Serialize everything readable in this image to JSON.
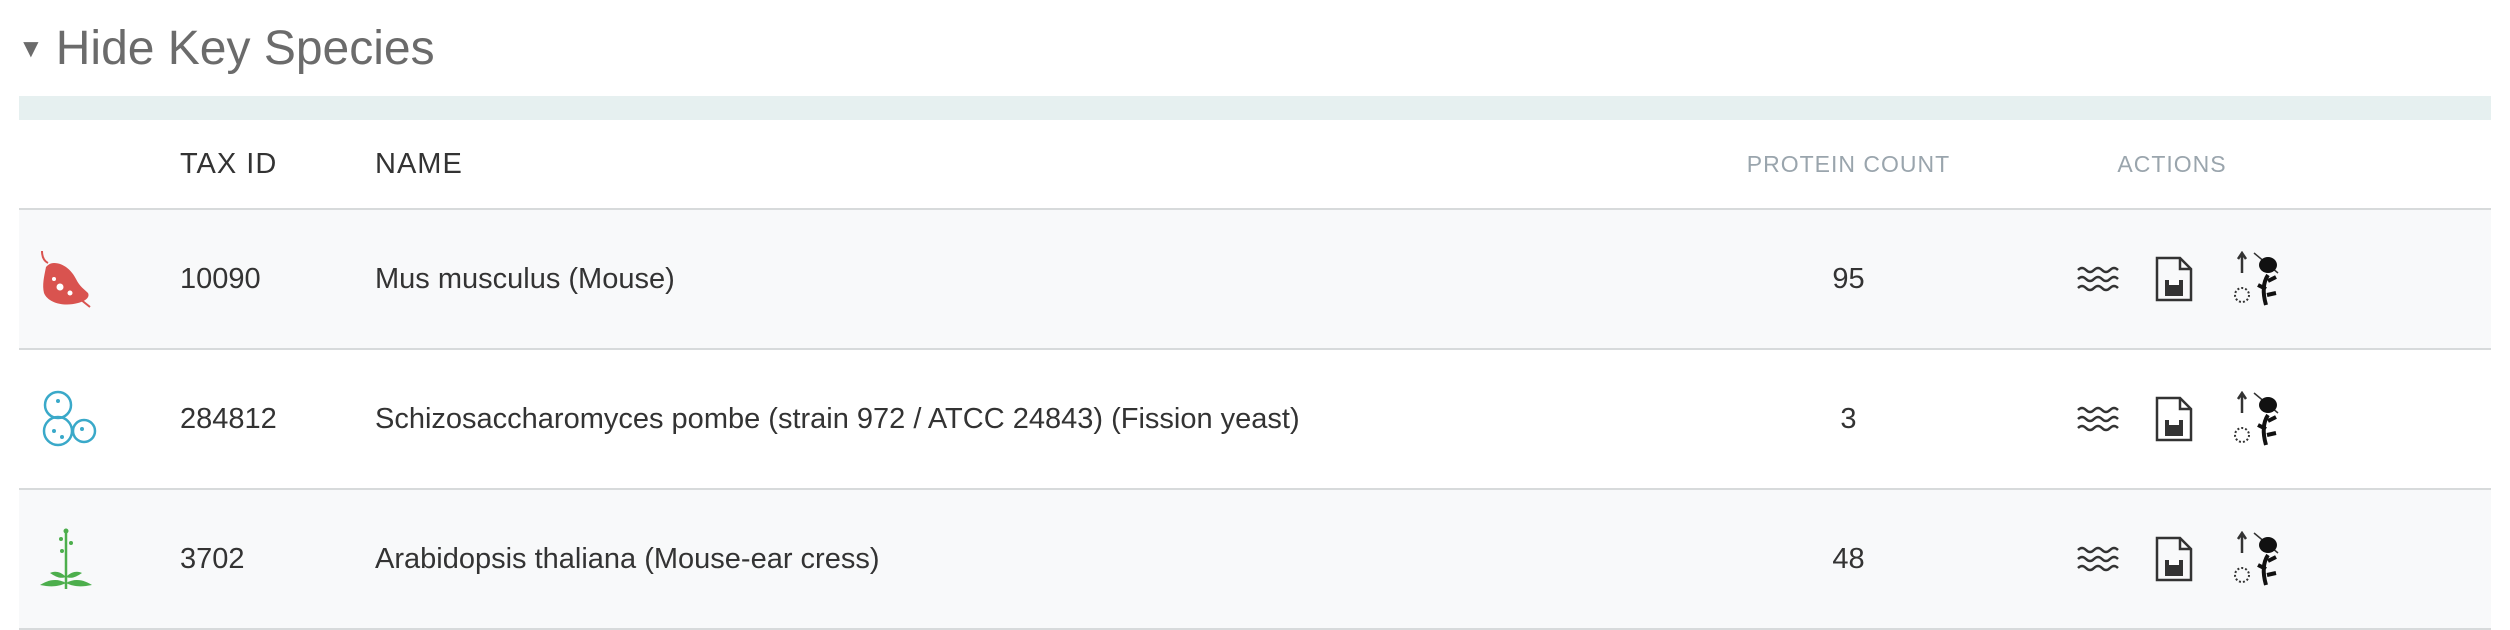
{
  "section": {
    "toggle_icon": "caret-down-icon",
    "title": "Hide Key Species"
  },
  "table": {
    "columns": {
      "icon": "",
      "tax_id": "TAX ID",
      "name": "NAME",
      "protein_count": "PROTEIN COUNT",
      "actions": "ACTIONS"
    },
    "rows": [
      {
        "icon": "mouse-icon",
        "icon_color": "#d9534f",
        "tax_id": "10090",
        "name": "Mus musculus (Mouse)",
        "protein_count": "95",
        "actions": [
          "sequence-alignment-icon",
          "save-file-icon",
          "species-tree-icon"
        ]
      },
      {
        "icon": "yeast-icon",
        "icon_color": "#3aa9c9",
        "tax_id": "284812",
        "name": "Schizosaccharomyces pombe (strain 972 / ATCC 24843) (Fission yeast)",
        "protein_count": "3",
        "actions": [
          "sequence-alignment-icon",
          "save-file-icon",
          "species-tree-icon"
        ]
      },
      {
        "icon": "arabidopsis-plant-icon",
        "icon_color": "#4cae4c",
        "tax_id": "3702",
        "name": "Arabidopsis thaliana (Mouse-ear cress)",
        "protein_count": "48",
        "actions": [
          "sequence-alignment-icon",
          "save-file-icon",
          "species-tree-icon"
        ]
      }
    ]
  }
}
